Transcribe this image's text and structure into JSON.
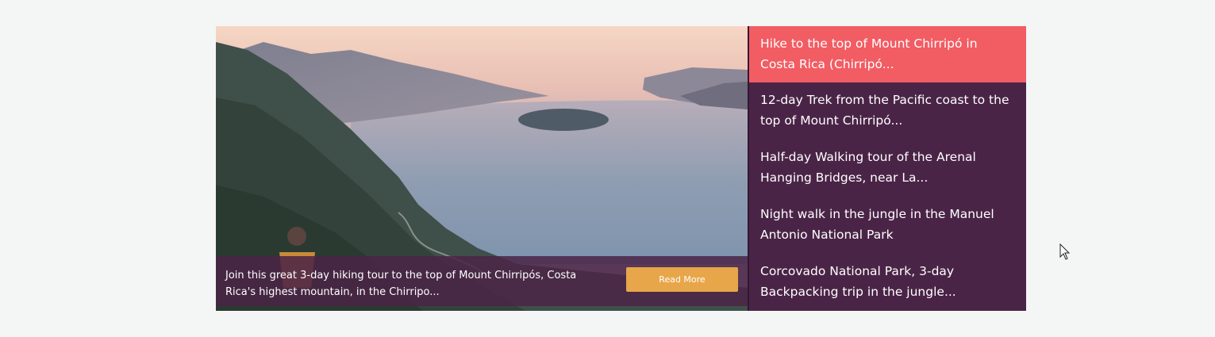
{
  "colors": {
    "page_background": "#f4f6f5",
    "panel_background": "#4a2447",
    "active_item": "#f25c63",
    "button": "#e8a64a"
  },
  "hero": {
    "image": "mountain-lake-sunset-photo",
    "caption": "Join this great 3-day hiking tour to the top of Mount Chirripós, Costa Rica's highest mountain, in the Chirripo...",
    "button_label": "Read More"
  },
  "tours": {
    "active_index": 0,
    "items": [
      {
        "title": "Hike to the top of Mount Chirripó in Costa Rica (Chirripó..."
      },
      {
        "title": "12-day Trek from the Pacific coast to the top of Mount Chirripó..."
      },
      {
        "title": "Half-day Walking tour of the Arenal Hanging Bridges, near La..."
      },
      {
        "title": "Night walk in the jungle in the Manuel Antonio National Park"
      },
      {
        "title": "Corcovado National Park, 3-day Backpacking trip in the jungle..."
      }
    ]
  },
  "cursor_icon": "mouse-pointer-icon"
}
